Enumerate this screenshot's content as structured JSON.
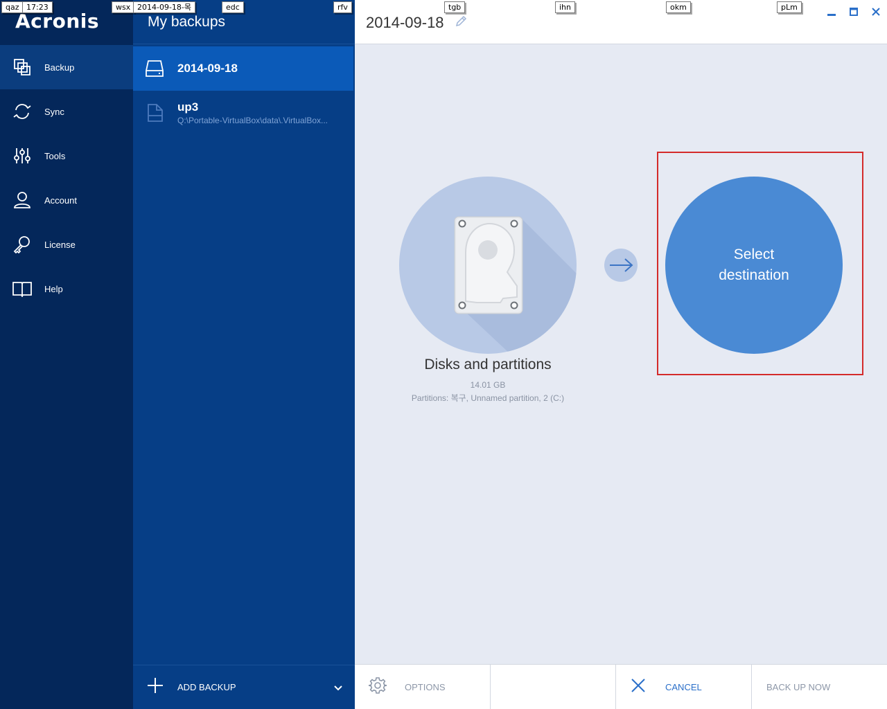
{
  "app": {
    "logo": "Acronis"
  },
  "nav": {
    "items": [
      {
        "label": "Backup",
        "icon": "backup-copy-icon",
        "active": true
      },
      {
        "label": "Sync",
        "icon": "sync-icon"
      },
      {
        "label": "Tools",
        "icon": "tools-sliders-icon"
      },
      {
        "label": "Account",
        "icon": "user-icon"
      },
      {
        "label": "License",
        "icon": "key-icon"
      },
      {
        "label": "Help",
        "icon": "book-icon"
      }
    ]
  },
  "backups": {
    "header": "My backups",
    "items": [
      {
        "name": "2014-09-18",
        "path": "",
        "icon": "drive-icon",
        "selected": true
      },
      {
        "name": "up3",
        "path": "Q:\\Portable-VirtualBox\\data\\.VirtualBox...",
        "icon": "file-icon"
      }
    ],
    "add_label": "ADD BACKUP"
  },
  "main": {
    "title": "2014-09-18",
    "source": {
      "title": "Disks and partitions",
      "size": "14.01 GB",
      "partitions": "Partitions: 복구, Unnamed partition, 2 (C:)"
    },
    "destination": {
      "line1": "Select",
      "line2": "destination"
    },
    "toolbar": {
      "options": "OPTIONS",
      "cancel": "CANCEL",
      "backup_now": "BACK UP NOW"
    }
  },
  "tags": [
    {
      "text": "qaz"
    },
    {
      "text": "17:23"
    },
    {
      "text": "wsx"
    },
    {
      "text": "2014-09-18-목"
    },
    {
      "text": "edc"
    },
    {
      "text": "rfv"
    },
    {
      "text": "tgb"
    },
    {
      "text": "ihn"
    },
    {
      "text": "okm"
    },
    {
      "text": "pLm"
    }
  ],
  "colors": {
    "nav_bg": "#04275a",
    "list_bg": "#063e86",
    "selected_row": "#0b5ab8",
    "destination": "#4a8ad4",
    "highlight": "#d42a2a",
    "window_control": "#2a6fc9"
  }
}
